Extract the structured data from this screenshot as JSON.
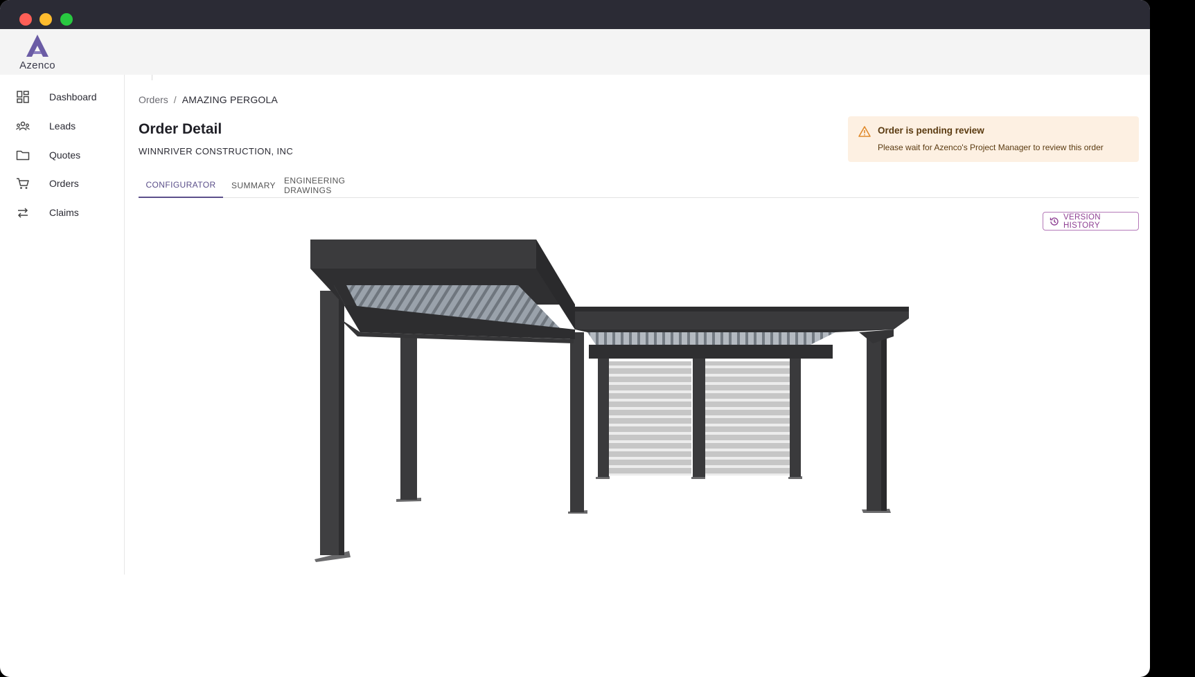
{
  "brand": {
    "name": "Azenco",
    "color": "#6b5ca5"
  },
  "sidebar": {
    "items": [
      {
        "label": "Dashboard",
        "icon": "dashboard-icon"
      },
      {
        "label": "Leads",
        "icon": "users-icon"
      },
      {
        "label": "Quotes",
        "icon": "folder-icon"
      },
      {
        "label": "Orders",
        "icon": "cart-icon"
      },
      {
        "label": "Claims",
        "icon": "swap-icon"
      }
    ]
  },
  "breadcrumb": {
    "parent": "Orders",
    "separator": "/",
    "current": "AMAZING PERGOLA"
  },
  "page": {
    "title": "Order Detail",
    "company": "WINNRIVER CONSTRUCTION, INC"
  },
  "alert": {
    "title": "Order is pending review",
    "message": "Please wait for Azenco's Project Manager to review this order",
    "icon": "warning-icon",
    "color": "#e08a2c"
  },
  "tabs": [
    {
      "label": "CONFIGURATOR",
      "active": true
    },
    {
      "label": "SUMMARY",
      "active": false
    },
    {
      "label": "ENGINEERING DRAWINGS",
      "active": false
    }
  ],
  "version_history": {
    "label": "VERSION HISTORY",
    "icon": "history-icon"
  },
  "colors": {
    "accent": "#5b4f8a",
    "button": "#8e3f93",
    "frame": "#3d3d3f"
  }
}
